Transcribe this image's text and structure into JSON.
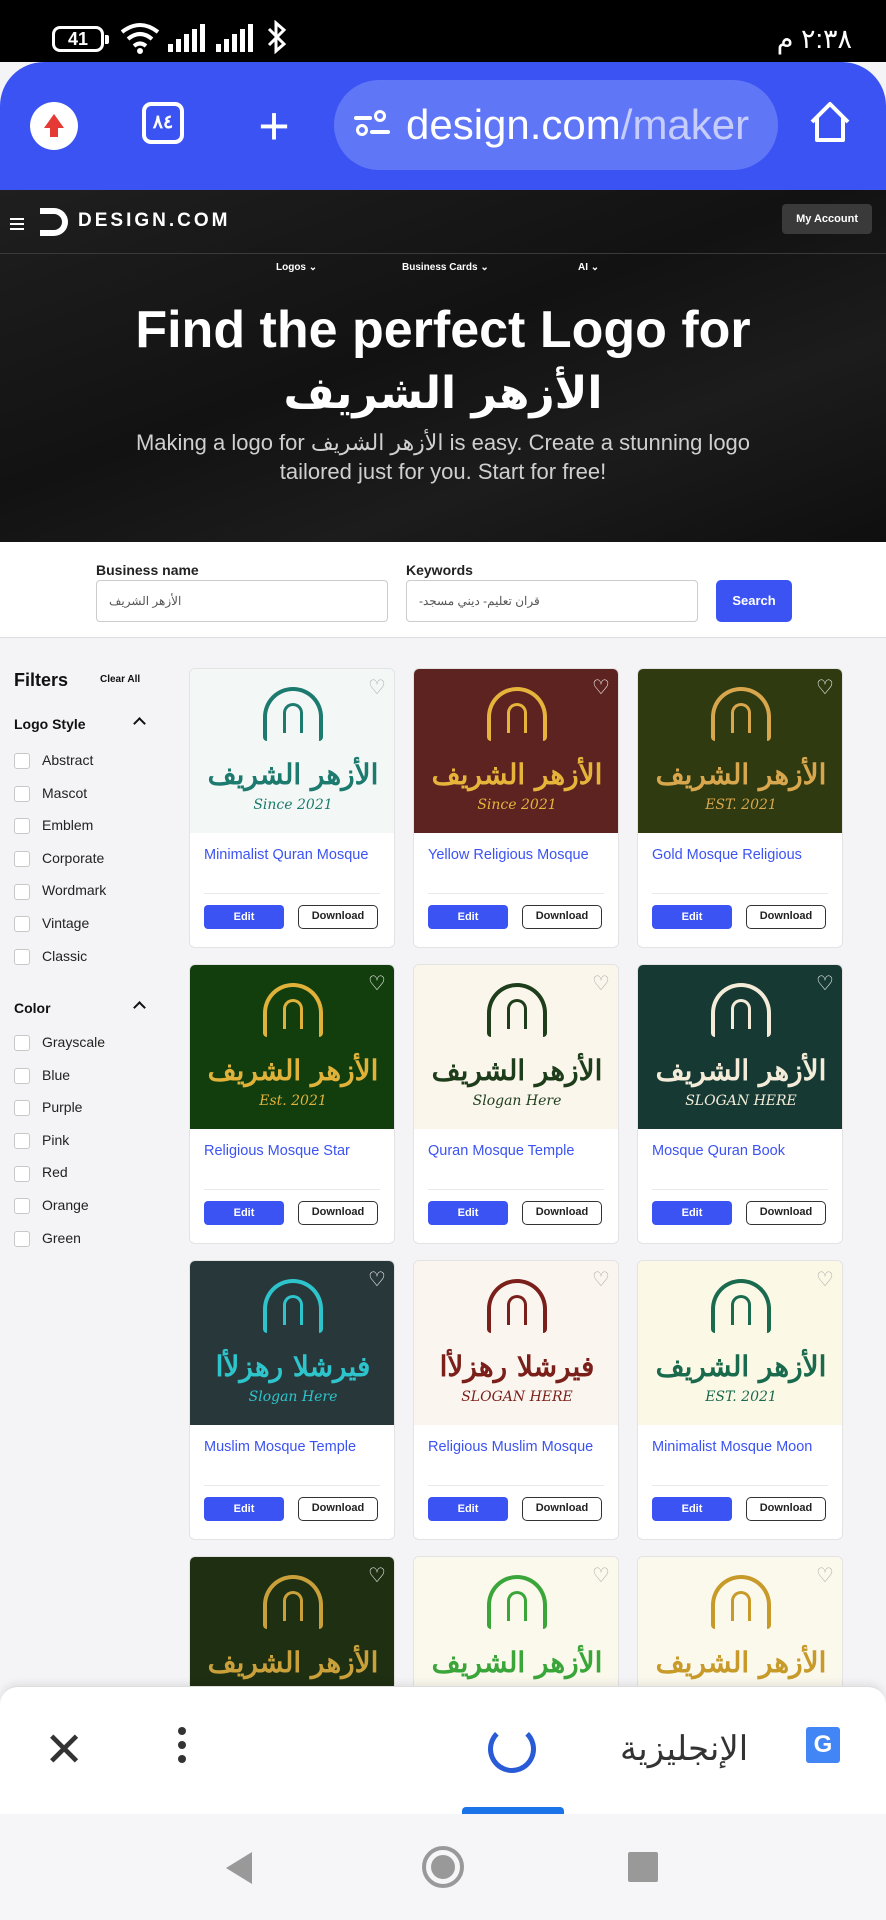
{
  "status_bar": {
    "battery": "41",
    "time": "٢:٣٨ م"
  },
  "browser": {
    "tab_count": "٨٤",
    "url_host": "design.com",
    "url_path": "/maker"
  },
  "site": {
    "brand": "DESIGN.COM",
    "account_button": "My Account",
    "nav": [
      "Logos",
      "Business Cards",
      "AI"
    ],
    "hero_title_line1": "Find the perfect Logo for",
    "hero_title_line2": "الأزهر الشريف",
    "hero_subtitle": "Making a logo for الأزهر الشريف is easy. Create a stunning logo tailored just for you. Start for free!"
  },
  "search": {
    "business_label": "Business name",
    "business_value": "الأزهر الشريف",
    "keywords_label": "Keywords",
    "keywords_value": "قران تعليم- ديني مسجد-",
    "button": "Search"
  },
  "filters": {
    "title": "Filters",
    "clear_all": "Clear All",
    "logo_style_title": "Logo Style",
    "logo_style": [
      "Abstract",
      "Mascot",
      "Emblem",
      "Corporate",
      "Wordmark",
      "Vintage",
      "Classic"
    ],
    "color_title": "Color",
    "colors": [
      "Grayscale",
      "Blue",
      "Purple",
      "Pink",
      "Red",
      "Orange",
      "Green"
    ]
  },
  "card_buttons": {
    "edit": "Edit",
    "download": "Download"
  },
  "logos": [
    {
      "title": "Minimalist Quran Mosque",
      "ar": "الأزهر الشريف",
      "tag": "Since 2021",
      "bg": "#f3f8f6",
      "fg": "#1c7a6e"
    },
    {
      "title": "Yellow Religious Mosque",
      "ar": "الأزهر الشريف",
      "tag": "Since 2021",
      "bg": "#5c2320",
      "fg": "#e6b43a"
    },
    {
      "title": "Gold Mosque Religious",
      "ar": "الأزهر الشريف",
      "tag": "EST. 2021",
      "bg": "#2f3a10",
      "fg": "#d8a64c"
    },
    {
      "title": "Religious Mosque Star",
      "ar": "الأزهر الشريف",
      "tag": "Est. 2021",
      "bg": "#123d0d",
      "fg": "#e0b23a"
    },
    {
      "title": "Quran Mosque Temple",
      "ar": "الأزهر الشريف",
      "tag": "Slogan Here",
      "bg": "#faf6ec",
      "fg": "#1e3d1a"
    },
    {
      "title": "Mosque Quran Book",
      "ar": "الأزهر الشريف",
      "tag": "SLOGAN HERE",
      "bg": "#163a33",
      "fg": "#f4ecd9"
    },
    {
      "title": "Muslim Mosque Temple",
      "ar": "فيرشلا رهزلأا",
      "tag": "Slogan Here",
      "bg": "#28373a",
      "fg": "#2ec4cc"
    },
    {
      "title": "Religious Muslim Mosque",
      "ar": "فيرشلا رهزلأا",
      "tag": "SLOGAN HERE",
      "bg": "#fbf5f0",
      "fg": "#7a1f1a"
    },
    {
      "title": "Minimalist Mosque Moon",
      "ar": "الأزهر الشريف",
      "tag": "EST. 2021",
      "bg": "#fbf8e6",
      "fg": "#1a6a4e"
    },
    {
      "title": "",
      "ar": "الأزهر الشريف",
      "tag": "",
      "bg": "#1f2f12",
      "fg": "#caa03a"
    },
    {
      "title": "",
      "ar": "الأزهر الشريف",
      "tag": "",
      "bg": "#fbf8ec",
      "fg": "#3aa63a"
    },
    {
      "title": "",
      "ar": "الأزهر الشريف",
      "tag": "",
      "bg": "#fbf8ec",
      "fg": "#c79a2a"
    }
  ],
  "translate_bar": {
    "close": "✕",
    "language": "الإنجليزية"
  }
}
